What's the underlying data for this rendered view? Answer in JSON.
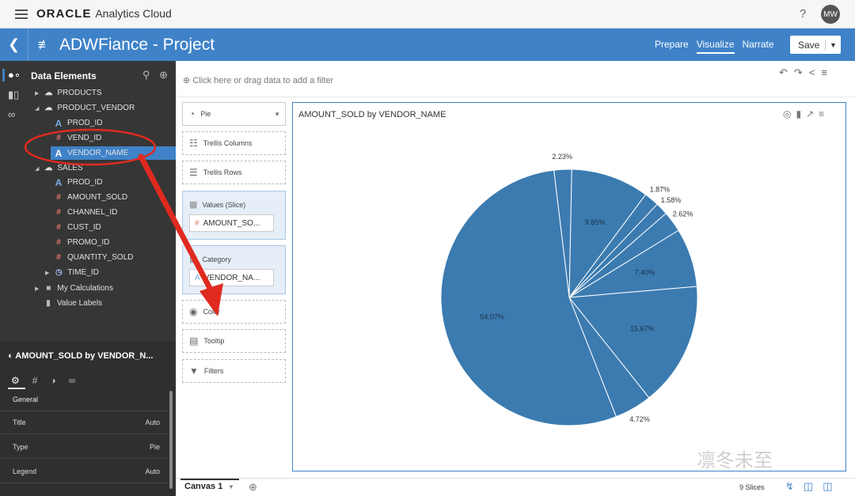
{
  "topbar": {
    "brand_oracle": "ORACLE",
    "brand_product": "Analytics Cloud",
    "help": "?",
    "avatar_initials": "MW"
  },
  "project": {
    "title": "ADWFiance - Project",
    "modes": [
      "Prepare",
      "Visualize",
      "Narrate"
    ],
    "active_mode": "Visualize",
    "save_label": "Save"
  },
  "data_elements": {
    "header": "Data Elements",
    "items": [
      {
        "label": "PRODUCTS",
        "icon": "dataset-icon"
      },
      {
        "label": "PRODUCT_VENDOR",
        "icon": "dataset-icon"
      },
      {
        "label": "PROD_ID",
        "icon": "attribute-icon"
      },
      {
        "label": "VEND_ID",
        "icon": "measure-icon"
      },
      {
        "label": "VENDOR_NAME",
        "icon": "attribute-icon"
      },
      {
        "label": "SALES",
        "icon": "dataset-icon"
      },
      {
        "label": "PROD_ID",
        "icon": "attribute-icon"
      },
      {
        "label": "AMOUNT_SOLD",
        "icon": "measure-icon"
      },
      {
        "label": "CHANNEL_ID",
        "icon": "measure-icon"
      },
      {
        "label": "CUST_ID",
        "icon": "measure-icon"
      },
      {
        "label": "PROMO_ID",
        "icon": "measure-icon"
      },
      {
        "label": "QUANTITY_SOLD",
        "icon": "measure-icon"
      },
      {
        "label": "TIME_ID",
        "icon": "time-icon"
      },
      {
        "label": "My Calculations",
        "icon": "folder-icon"
      },
      {
        "label": "Value Labels",
        "icon": "label-icon"
      }
    ]
  },
  "properties": {
    "title": "AMOUNT_SOLD by VENDOR_N...",
    "section": "General",
    "rows": [
      {
        "label": "Title",
        "value": "Auto"
      },
      {
        "label": "Type",
        "value": "Pie"
      },
      {
        "label": "Legend",
        "value": "Auto"
      }
    ]
  },
  "filterbar": {
    "placeholder": "Click here or drag data to add a filter"
  },
  "grammar": {
    "viz_type": "Pie",
    "trellis_columns": "Trellis Columns",
    "trellis_rows": "Trellis Rows",
    "values_label": "Values (Slice)",
    "values_pill": "AMOUNT_SO...",
    "category_label": "Category",
    "category_pill": "VENDOR_NA...",
    "color": "Color",
    "tooltip": "Tooltip",
    "filters": "Filters"
  },
  "viz": {
    "title": "AMOUNT_SOLD by VENDOR_NAME"
  },
  "chart_data": {
    "type": "pie",
    "title": "AMOUNT_SOLD by VENDOR_NAME",
    "values": [
      2.23,
      9.85,
      1.87,
      1.58,
      2.62,
      7.4,
      15.67,
      4.72,
      54.07
    ],
    "labels": [
      "2.23%",
      "9.85%",
      "1.87%",
      "1.58%",
      "2.62%",
      "7.40%",
      "15.67%",
      "4.72%",
      "54.07%"
    ],
    "color": "#3b7bb0"
  },
  "bottombar": {
    "canvas_tab": "Canvas 1",
    "slices": "9 Slices"
  },
  "watermark": "凛冬未至"
}
